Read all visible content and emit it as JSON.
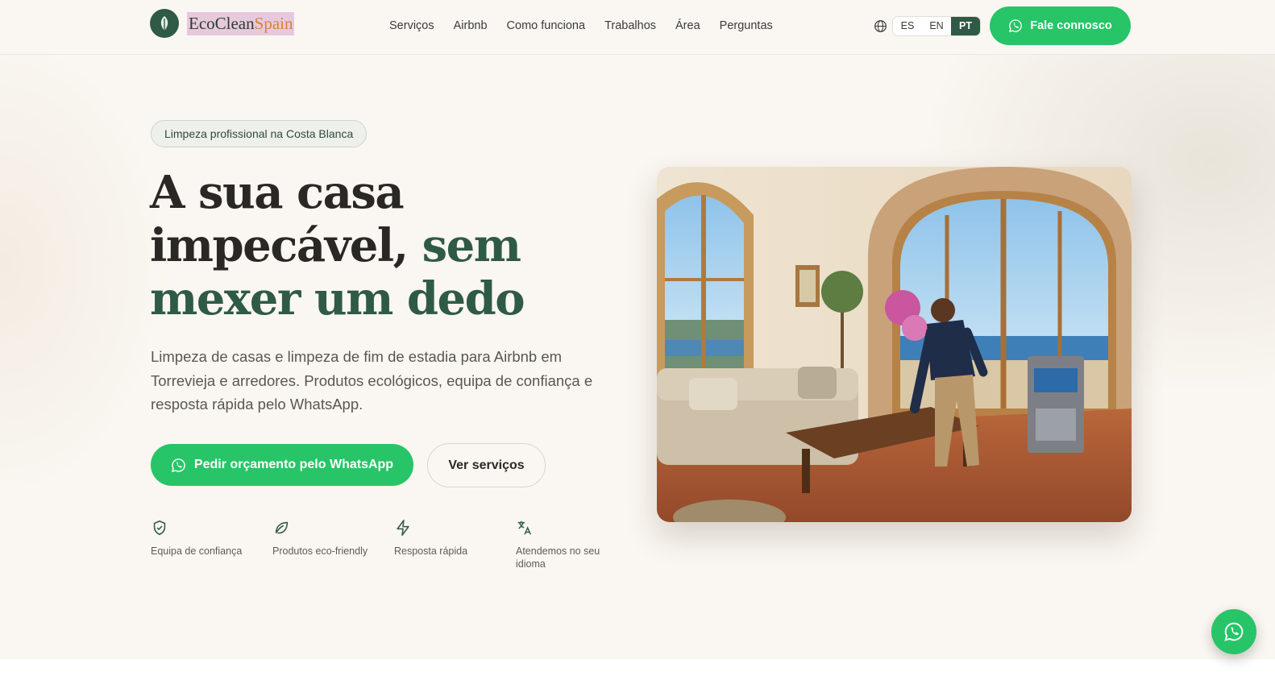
{
  "brand": {
    "name_part1": "EcoClean",
    "name_part2": "Spain"
  },
  "nav": {
    "items": [
      "Serviços",
      "Airbnb",
      "Como funciona",
      "Trabalhos",
      "Área",
      "Perguntas"
    ]
  },
  "language": {
    "options": [
      "ES",
      "EN",
      "PT"
    ],
    "selected": "PT"
  },
  "header_cta": {
    "label": "Fale connosco"
  },
  "hero": {
    "badge": "Limpeza profissional na Costa Blanca",
    "headline_plain": "A sua casa impecável, ",
    "headline_accent": "sem mexer um dedo",
    "lead": "Limpeza de casas e limpeza de fim de estadia para Airbnb em Torrevieja e arredores. Produtos ecológicos, equipa de confiança e resposta rápida pelo WhatsApp.",
    "primary_button": "Pedir orçamento pelo WhatsApp",
    "secondary_button": "Ver serviços"
  },
  "features": [
    {
      "icon": "shield-check-icon",
      "label": "Equipa de confiança"
    },
    {
      "icon": "leaf-icon",
      "label": "Produtos eco-friendly"
    },
    {
      "icon": "zap-icon",
      "label": "Resposta rápida"
    },
    {
      "icon": "translate-icon",
      "label": "Atendemos no seu idioma"
    }
  ],
  "colors": {
    "accent_green": "#27c567",
    "brand_green": "#2f5a46",
    "brand_orange": "#d9803c",
    "background": "#faf6f1"
  }
}
